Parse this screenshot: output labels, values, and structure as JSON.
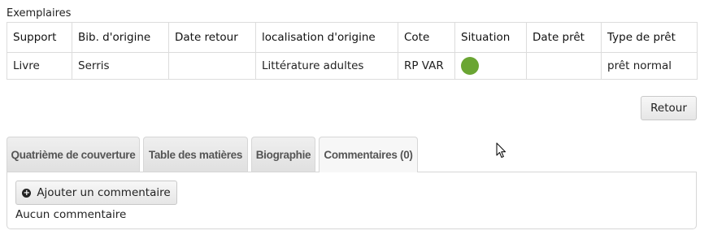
{
  "section": {
    "title": "Exemplaires"
  },
  "table": {
    "headers": [
      "Support",
      "Bib. d'origine",
      "Date retour",
      "localisation d'origine",
      "Cote",
      "Situation",
      "Date prêt",
      "Type de prêt"
    ],
    "rows": [
      {
        "support": "Livre",
        "bib": "Serris",
        "date_retour": "",
        "localisation": "Littérature adultes",
        "cote": "RP VAR",
        "situation_color": "#6aa533",
        "date_pret": "",
        "type_pret": "prêt normal"
      }
    ]
  },
  "buttons": {
    "retour": "Retour",
    "add_comment": "Ajouter un commentaire"
  },
  "tabs": [
    {
      "label": "Quatrième de couverture",
      "active": false
    },
    {
      "label": "Table des matières",
      "active": false
    },
    {
      "label": "Biographie",
      "active": false
    },
    {
      "label": "Commentaires (0)",
      "active": true
    }
  ],
  "comments": {
    "empty_text": "Aucun commentaire"
  },
  "icons": {
    "add": "plus-circle-icon",
    "cursor": "mouse-cursor-icon"
  }
}
